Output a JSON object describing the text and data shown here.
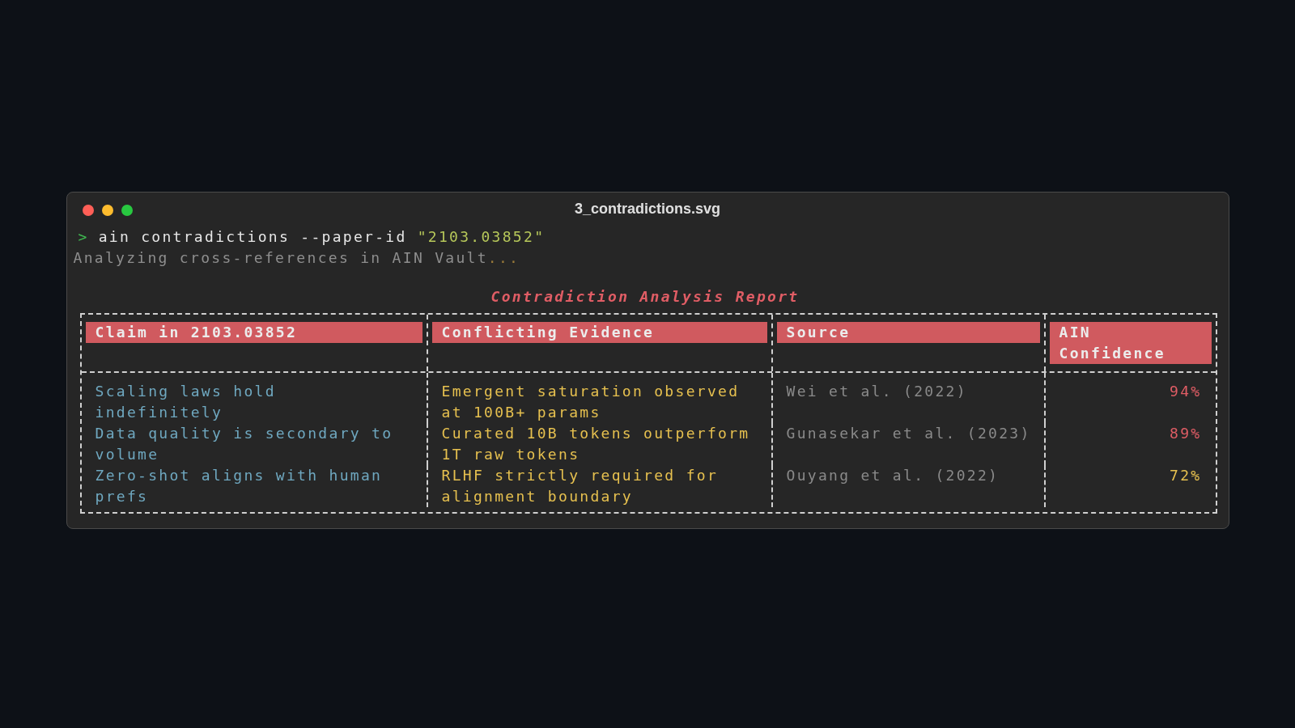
{
  "window": {
    "title": "3_contradictions.svg"
  },
  "prompt": {
    "symbol": ">",
    "command": "ain contradictions --paper-id",
    "argument": "\"2103.03852\""
  },
  "status": {
    "text": "Analyzing cross-references in AIN Vault",
    "ellipsis": "..."
  },
  "report_title": "Contradiction Analysis Report",
  "table": {
    "columns": [
      "Claim in 2103.03852",
      "Conflicting Evidence",
      "Source",
      "AIN Confidence"
    ],
    "rows": [
      {
        "claim": "Scaling laws hold indefinitely",
        "evidence": "Emergent saturation observed at 100B+ params",
        "source": "Wei et al. (2022)",
        "confidence": "94%",
        "color": "#e05d65"
      },
      {
        "claim": "Data quality is secondary to volume",
        "evidence": "Curated 10B tokens outperform 1T raw tokens",
        "source": "Gunasekar et al. (2023)",
        "confidence": "89%",
        "color": "#e05d65"
      },
      {
        "claim": "Zero-shot aligns with human prefs",
        "evidence": "RLHF strictly required for alignment boundary",
        "source": "Ouyang et al. (2022)",
        "confidence": "72%",
        "color": "#e6c04f"
      }
    ]
  }
}
